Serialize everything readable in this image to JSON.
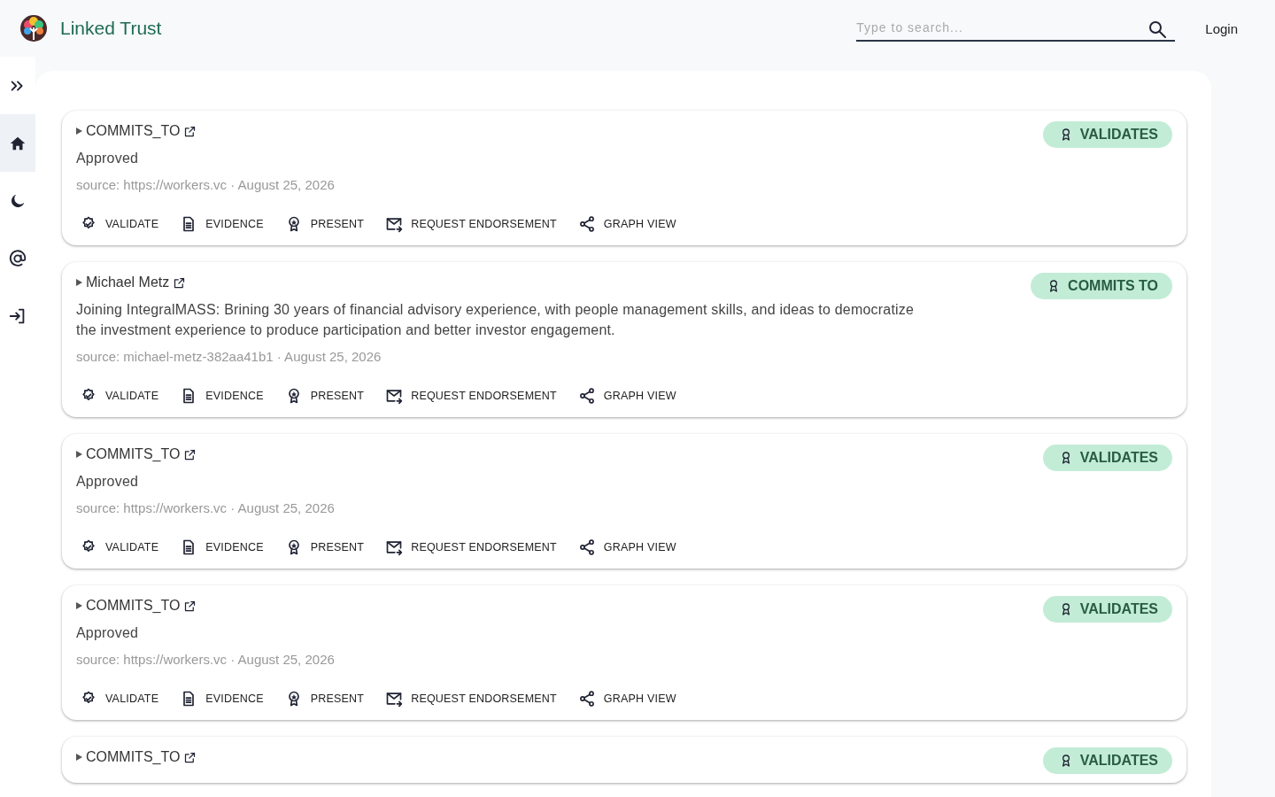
{
  "header": {
    "brand": "Linked Trust",
    "search": {
      "placeholder": "Type to search..."
    },
    "login": "Login"
  },
  "sidebar": {
    "items": [
      {
        "kind": "expand",
        "selected": false
      },
      {
        "kind": "home",
        "selected": true
      },
      {
        "kind": "theme",
        "selected": false
      },
      {
        "kind": "at",
        "selected": false
      },
      {
        "kind": "login",
        "selected": false
      }
    ]
  },
  "claims": [
    {
      "title": "COMMITS_TO",
      "statement": "Approved",
      "source": "source: https://workers.vc · August 25, 2026",
      "badge": "VALIDATES",
      "actions": [
        {
          "kind": "validate",
          "label": "VALIDATE"
        },
        {
          "kind": "evidence",
          "label": "EVIDENCE"
        },
        {
          "kind": "present",
          "label": "PRESENT"
        },
        {
          "kind": "request",
          "label": "REQUEST ENDORSEMENT"
        },
        {
          "kind": "graph",
          "label": "GRAPH VIEW"
        }
      ]
    },
    {
      "title": "Michael Metz",
      "statement": "Joining IntegralMASS: Brining 30 years of financial advisory experience, with people management skills, and ideas to democratize the investment experience to produce participation and better investor engagement.",
      "source": "source: michael-metz-382aa41b1 · August 25, 2026",
      "badge": "COMMITS TO",
      "actions": [
        {
          "kind": "validate",
          "label": "VALIDATE"
        },
        {
          "kind": "evidence",
          "label": "EVIDENCE"
        },
        {
          "kind": "present",
          "label": "PRESENT"
        },
        {
          "kind": "request",
          "label": "REQUEST ENDORSEMENT"
        },
        {
          "kind": "graph",
          "label": "GRAPH VIEW"
        }
      ]
    },
    {
      "title": "COMMITS_TO",
      "statement": "Approved",
      "source": "source: https://workers.vc · August 25, 2026",
      "badge": "VALIDATES",
      "actions": [
        {
          "kind": "validate",
          "label": "VALIDATE"
        },
        {
          "kind": "evidence",
          "label": "EVIDENCE"
        },
        {
          "kind": "present",
          "label": "PRESENT"
        },
        {
          "kind": "request",
          "label": "REQUEST ENDORSEMENT"
        },
        {
          "kind": "graph",
          "label": "GRAPH VIEW"
        }
      ]
    },
    {
      "title": "COMMITS_TO",
      "statement": "Approved",
      "source": "source: https://workers.vc · August 25, 2026",
      "badge": "VALIDATES",
      "actions": [
        {
          "kind": "validate",
          "label": "VALIDATE"
        },
        {
          "kind": "evidence",
          "label": "EVIDENCE"
        },
        {
          "kind": "present",
          "label": "PRESENT"
        },
        {
          "kind": "request",
          "label": "REQUEST ENDORSEMENT"
        },
        {
          "kind": "graph",
          "label": "GRAPH VIEW"
        }
      ]
    },
    {
      "title": "COMMITS_TO",
      "badge": "VALIDATES"
    }
  ]
}
